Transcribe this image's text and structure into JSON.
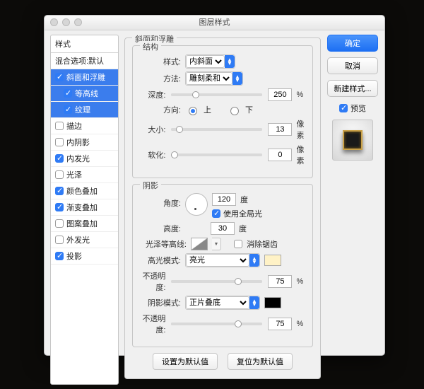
{
  "window_title": "图层样式",
  "styles_header": "样式",
  "styles_list": {
    "blend_defaults": "混合选项:默认",
    "bevel": {
      "label": "斜面和浮雕",
      "checked": true,
      "selected": true
    },
    "contour_sub": {
      "label": "等高线",
      "checked": true,
      "selected": true
    },
    "texture_sub": {
      "label": "纹理",
      "checked": true,
      "selected": true
    },
    "stroke": {
      "label": "描边",
      "checked": false
    },
    "inner_shadow": {
      "label": "内阴影",
      "checked": false
    },
    "inner_glow": {
      "label": "内发光",
      "checked": true
    },
    "satin": {
      "label": "光泽",
      "checked": false
    },
    "color_overlay": {
      "label": "颜色叠加",
      "checked": true
    },
    "gradient_overlay": {
      "label": "渐变叠加",
      "checked": true
    },
    "pattern_overlay": {
      "label": "图案叠加",
      "checked": false
    },
    "outer_glow": {
      "label": "外发光",
      "checked": false
    },
    "drop_shadow": {
      "label": "投影",
      "checked": true
    }
  },
  "panel_label": "斜面和浮雕",
  "structure": {
    "legend": "结构",
    "style": {
      "label": "样式:",
      "value": "内斜面"
    },
    "technique": {
      "label": "方法:",
      "value": "雕刻柔和"
    },
    "depth": {
      "label": "深度:",
      "value": "250",
      "unit": "%"
    },
    "direction": {
      "label": "方向:",
      "up": "上",
      "down": "下"
    },
    "size_f": {
      "label": "大小:",
      "value": "13",
      "unit": "像素"
    },
    "soften": {
      "label": "软化:",
      "value": "0",
      "unit": "像素"
    }
  },
  "shading": {
    "legend": "阴影",
    "angle": {
      "label": "角度:",
      "value": "120",
      "unit": "度"
    },
    "global": {
      "label": "使用全局光",
      "checked": true
    },
    "altitude": {
      "label": "高度:",
      "value": "30",
      "unit": "度"
    },
    "gloss": {
      "label": "光泽等高线:",
      "aa": "消除锯齿",
      "aa_checked": false
    },
    "highlight": {
      "mode_label": "高光模式:",
      "mode": "亮光",
      "swatch": "#fff2c6",
      "opacity_label": "不透明度:",
      "opacity": "75",
      "unit": "%"
    },
    "shadow": {
      "mode_label": "阴影模式:",
      "mode": "正片叠底",
      "swatch": "#000000",
      "opacity_label": "不透明度:",
      "opacity": "75",
      "unit": "%"
    }
  },
  "footer": {
    "make_default": "设置为默认值",
    "reset_default": "复位为默认值"
  },
  "side": {
    "ok": "确定",
    "cancel": "取消",
    "new_style": "新建样式...",
    "preview_label": "预览",
    "preview_checked": true
  }
}
